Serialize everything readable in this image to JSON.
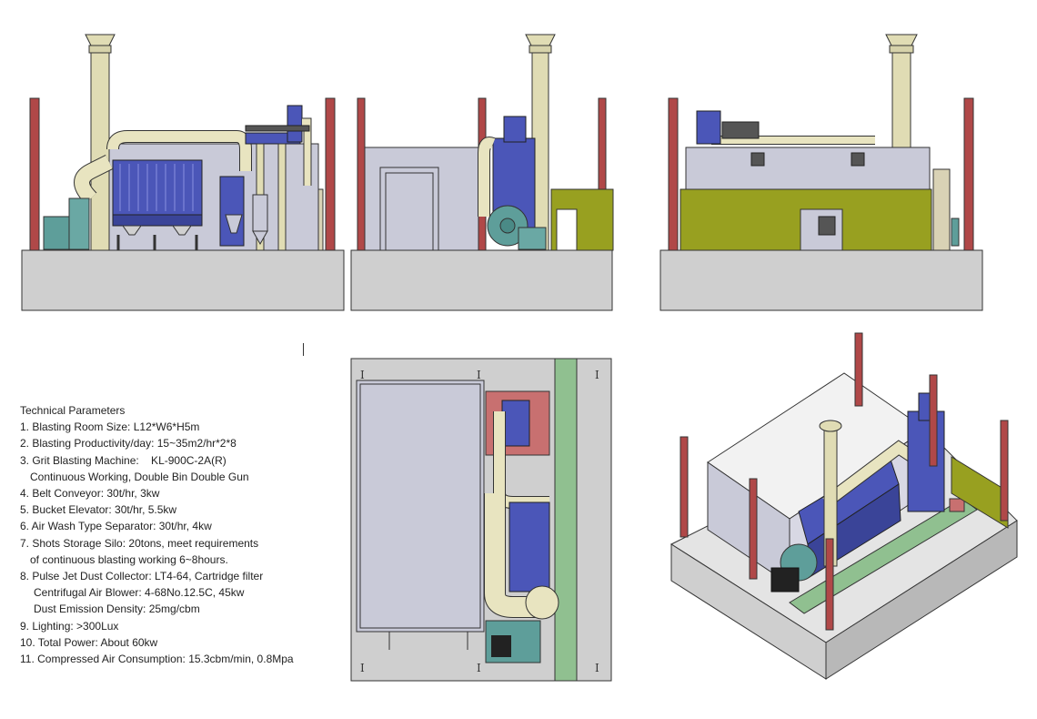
{
  "technical_parameters": {
    "heading": "Technical Parameters",
    "lines": [
      "1. Blasting Room Size: L12*W6*H5m",
      "2. Blasting Productivity/day: 15~35m2/hr*2*8",
      "3. Grit Blasting Machine:    KL-900C-2A(R)",
      "Continuous Working, Double Bin Double Gun",
      "4. Belt Conveyor: 30t/hr, 3kw",
      "5. Bucket Elevator: 30t/hr, 5.5kw",
      "6. Air Wash Type Separator: 30t/hr, 4kw",
      "7. Shots Storage Silo: 20tons, meet requirements",
      "of continuous blasting working 6~8hours.",
      "8. Pulse Jet Dust Collector: LT4-64, Cartridge filter",
      "Centrifugal Air Blower: 4-68No.12.5C, 45kw",
      "Dust Emission Density: 25mg/cbm",
      "9. Lighting: >300Lux",
      "10. Total Power: About 60kw",
      "11. Compressed Air Consumption: 15.3cbm/min, 0.8Mpa"
    ]
  },
  "plan_markers": [
    "I",
    "I",
    "I",
    "I",
    "I",
    "I"
  ],
  "colors": {
    "base": "#cfcfcf",
    "wall": "#c9cad8",
    "pipe": "#e8e4c0",
    "machine_blue": "#4b56b8",
    "olive": "#98a020",
    "column_red": "#b04848",
    "fan_teal": "#5e9e9a",
    "walkway_green": "#90c090",
    "outline": "#333333"
  }
}
